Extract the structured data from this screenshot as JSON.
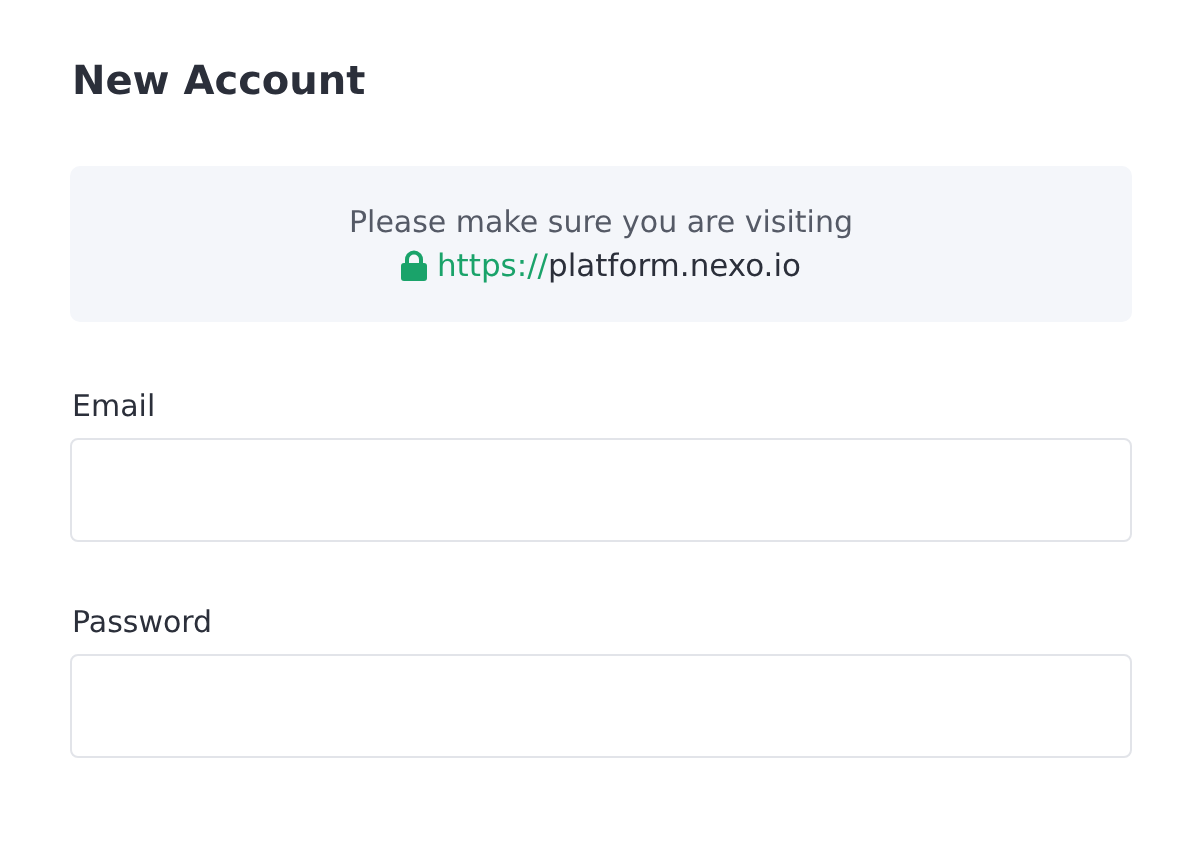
{
  "title": "New Account",
  "notice": {
    "text": "Please make sure you are visiting",
    "url_scheme": "https://",
    "url_host": "platform.nexo.io"
  },
  "fields": [
    {
      "label": "Email"
    },
    {
      "label": "Password"
    }
  ]
}
